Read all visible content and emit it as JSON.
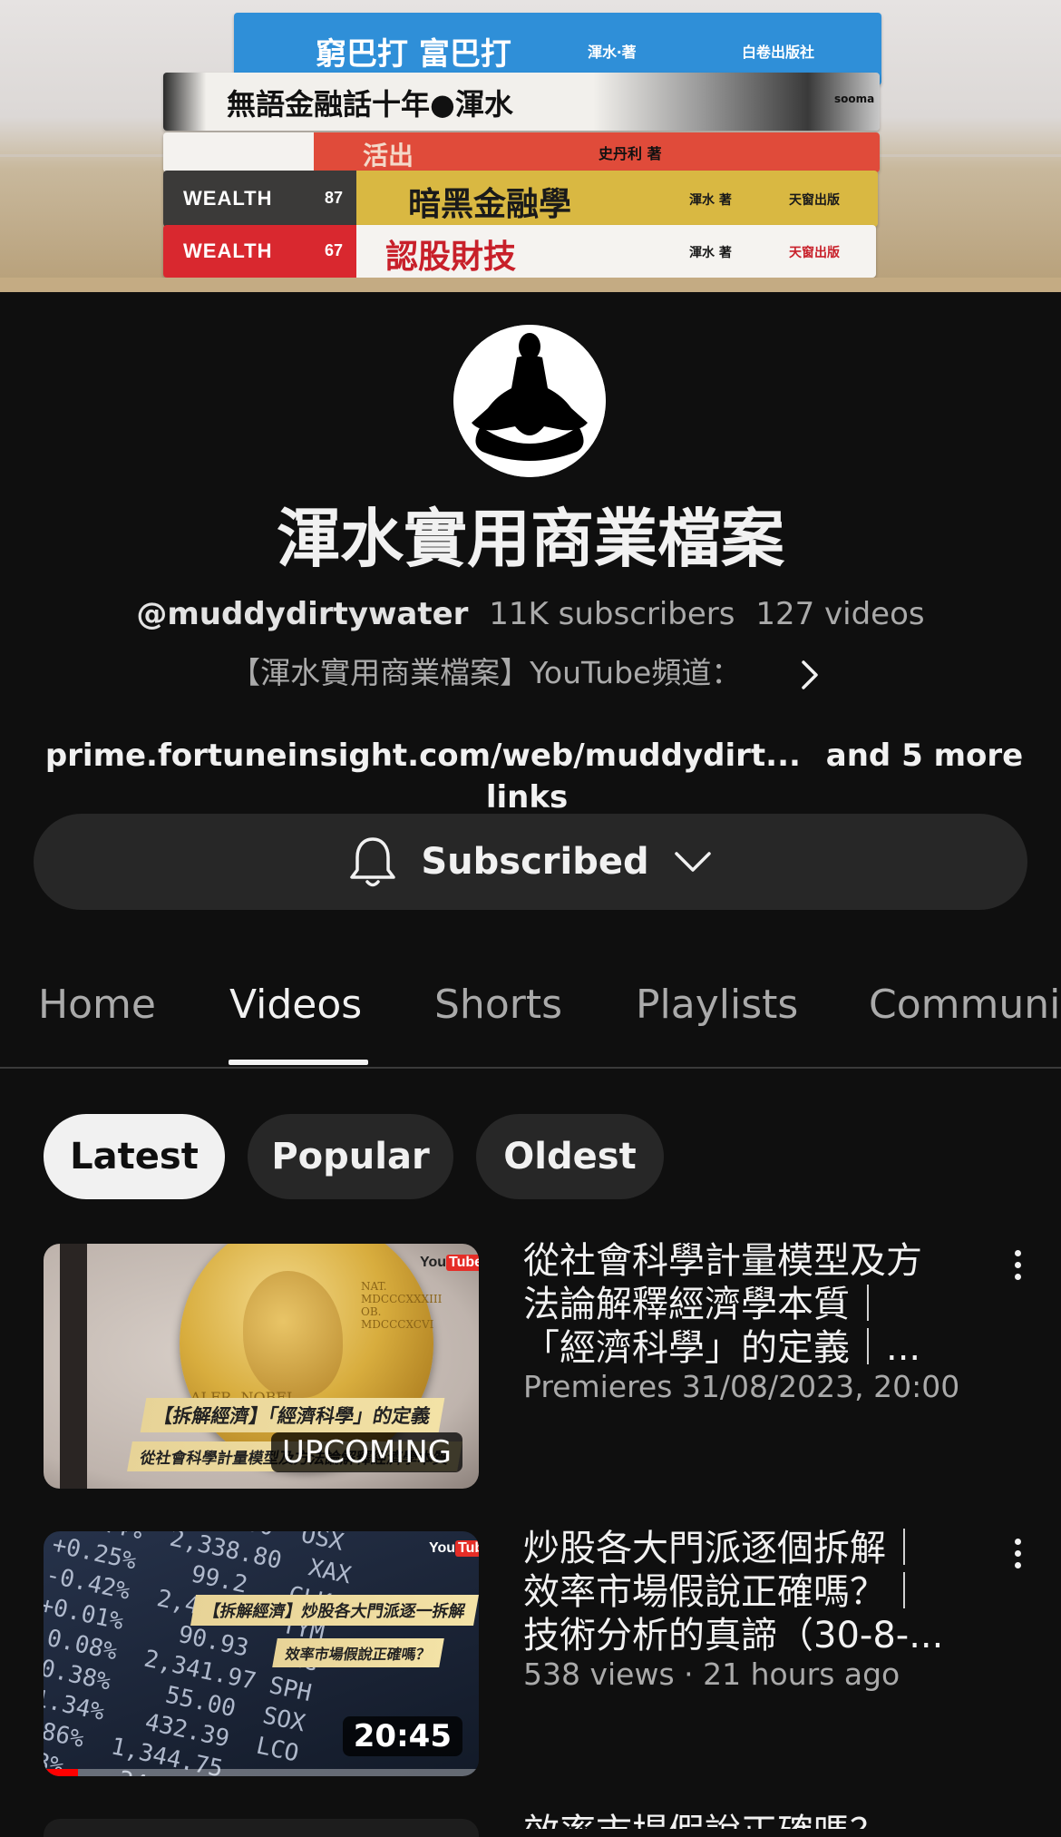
{
  "banner": {
    "books": [
      {
        "title": "窮巴打 富巴打",
        "author": "渾水‧著",
        "publisher": "白卷出版社"
      },
      {
        "title": "無語金融話十年●渾水",
        "publisher": "sooma"
      },
      {
        "title": "活出",
        "author": "史丹利 著"
      },
      {
        "series": "WEALTH",
        "number": "87",
        "title": "暗黑金融學",
        "author": "渾水 著",
        "publisher": "天窗出版"
      },
      {
        "series": "WEALTH",
        "number": "67",
        "title": "認股財技",
        "author": "渾水 著",
        "publisher": "天窗出版"
      }
    ]
  },
  "channel": {
    "name": "渾水實用商業檔案",
    "handle": "@muddydirtywater",
    "subscribers": "11K subscribers",
    "videos_count": "127 videos",
    "description": "【渾水實用商業檔案】YouTube頻道：",
    "link": "prime.fortuneinsight.com/web/muddydirt...",
    "more_links": "and 5 more links",
    "subscribe_label": "Subscribed"
  },
  "tabs": [
    {
      "label": "Home"
    },
    {
      "label": "Videos",
      "active": true
    },
    {
      "label": "Shorts"
    },
    {
      "label": "Playlists"
    },
    {
      "label": "Communi"
    }
  ],
  "chips": [
    {
      "label": "Latest",
      "active": true
    },
    {
      "label": "Popular"
    },
    {
      "label": "Oldest"
    }
  ],
  "videos": [
    {
      "title_lines": [
        "從社會科學計量模型及方",
        "法論解釋經濟學本質｜",
        "「經濟科學」的定義｜..."
      ],
      "meta": "Premieres 31/08/2023, 20:00",
      "badge": "UPCOMING",
      "thumb_caption_1": "【拆解經濟】「經濟科學」的定義",
      "thumb_caption_2": "從社會科學計量模型及方法論解釋經濟學本質",
      "medal_text": "ALFR. NOBEL",
      "medal_date": "NAT. MDCCCXXXIII OB. MDCCCXCVI",
      "logo_you": "You",
      "logo_tube": "Tube"
    },
    {
      "title_lines": [
        "炒股各大門派逐個拆解｜",
        "效率市場假說正確嗎？｜",
        "技術分析的真諦（30-8-..."
      ],
      "meta": "538 views · 21 hours ago",
      "badge": "20:45",
      "thumb_caption_1": "【拆解經濟】炒股各大門派逐一拆解",
      "thumb_caption_2": "效率市場假說正確嗎？",
      "logo_you": "You",
      "logo_tube": "Tube",
      "progress": 0.08
    }
  ],
  "next_video_peek": "效率市場假說正確嗎？"
}
